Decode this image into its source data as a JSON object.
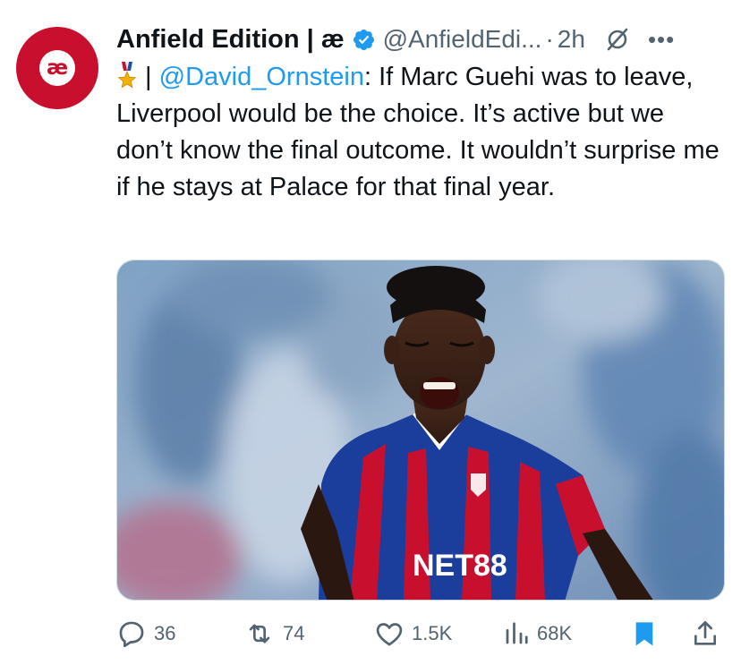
{
  "account": {
    "display_name": "Anfield Edition | æ",
    "handle": "@AnfieldEdi...",
    "separator": "·",
    "time": "2h",
    "avatar_text": "æ",
    "verified_color": "#1d9bf0",
    "brand_color": "#c8102e"
  },
  "tweet": {
    "badge_icon": "military-medal",
    "divider": " | ",
    "mention": "@David_Ornstein",
    "text": ": If Marc Guehi was to leave, Liverpool would be the choice. It’s active but we don’t know the final outcome. It wouldn’t surprise me if he stays at Palace for that final year.",
    "link_color": "#1d9bf0"
  },
  "media": {
    "jersey_sponsor": "NET88"
  },
  "actions": {
    "reply_count": "36",
    "retweet_count": "74",
    "like_count": "1.5K",
    "views_count": "68K",
    "bookmark_color": "#1d9bf0"
  },
  "icons": {
    "more": "•••",
    "grok": "grok-icon",
    "share": "share-icon"
  }
}
